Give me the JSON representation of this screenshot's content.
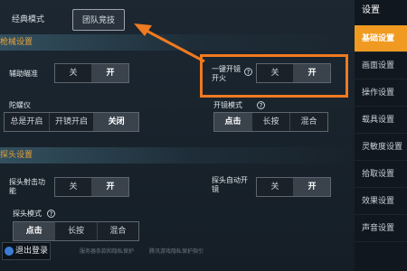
{
  "modes": {
    "classic": "经典模式",
    "team": "团队竞技"
  },
  "sections": {
    "firearm": "枪械设置",
    "peek": "探头设置"
  },
  "settings": {
    "aim_assist": {
      "label": "辅助瞄准",
      "options": [
        "关",
        "开"
      ],
      "selected": "开"
    },
    "one_tap_fire": {
      "label": "一键开镜开火",
      "options": [
        "关",
        "开"
      ],
      "selected": "开"
    },
    "gyroscope": {
      "label": "陀螺仪",
      "options": [
        "总是开启",
        "开镜开启",
        "关闭"
      ],
      "selected": "关闭"
    },
    "scope_mode": {
      "label": "开镜模式",
      "options": [
        "点击",
        "长按",
        "混合"
      ],
      "selected": "点击"
    },
    "peek_fire": {
      "label": "探头射击功能",
      "options": [
        "关",
        "开"
      ],
      "selected": "开"
    },
    "peek_auto_scope": {
      "label": "探头自动开镜",
      "options": [
        "关",
        "开"
      ],
      "selected": "开"
    },
    "peek_mode": {
      "label": "探头模式",
      "options": [
        "点击",
        "长按",
        "混合"
      ],
      "selected": "点击"
    }
  },
  "hint_symbol": "?",
  "sidebar": {
    "title": "设置",
    "items": [
      "基础设置",
      "画面设置",
      "操作设置",
      "载具设置",
      "灵敏度设置",
      "拾取设置",
      "效果设置",
      "声音设置"
    ],
    "active_index": 0
  },
  "footer": {
    "logout": "退出登录",
    "link1": "服务器条款和隐私保护",
    "link2": "腾讯游戏隐私保护指引"
  },
  "colors": {
    "accent": "#f09a22",
    "highlight": "#ef7a20",
    "section_text": "#e6a23c"
  }
}
